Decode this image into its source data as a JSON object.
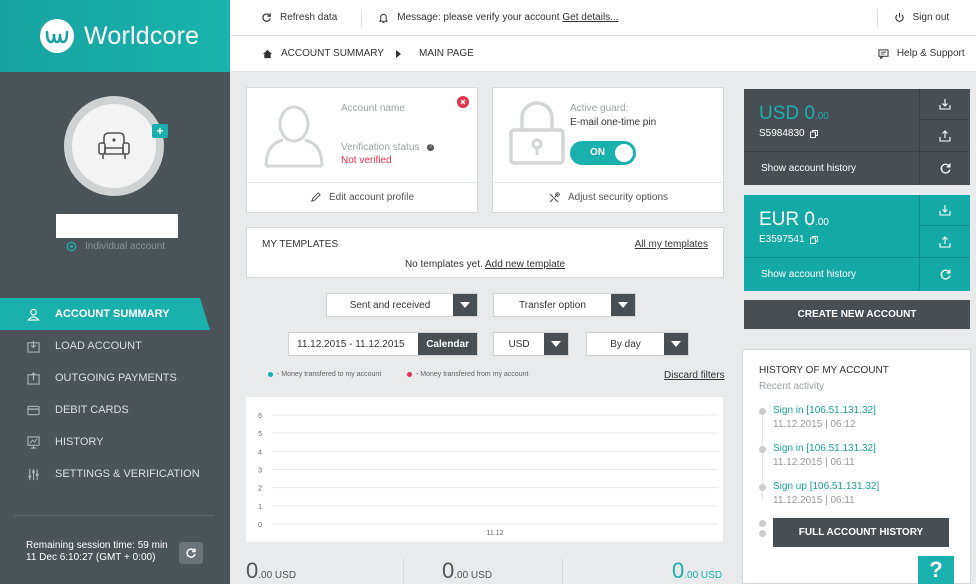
{
  "brand": {
    "name": "Worldcore"
  },
  "sidebar": {
    "account_type": "Individual account",
    "items": [
      {
        "label": "ACCOUNT SUMMARY",
        "icon": "user-icon",
        "active": true
      },
      {
        "label": "LOAD ACCOUNT",
        "icon": "load-icon"
      },
      {
        "label": "OUTGOING PAYMENTS",
        "icon": "upload-icon"
      },
      {
        "label": "DEBIT CARDS",
        "icon": "card-icon"
      },
      {
        "label": "HISTORY",
        "icon": "chart-icon"
      },
      {
        "label": "SETTINGS & VERIFICATION",
        "icon": "sliders-icon"
      }
    ],
    "session_line1": "Remaining session time: 59 min",
    "session_line2": "11 Dec 6:10:27 (GMT + 0:00)"
  },
  "topbar": {
    "refresh": "Refresh data",
    "message": "Message: please verify your account",
    "message_link": "Get details...",
    "signout": "Sign out"
  },
  "breadcrumb": {
    "first": "ACCOUNT SUMMARY",
    "second": "MAIN PAGE",
    "help": "Help & Support"
  },
  "profile": {
    "name_label": "Account name",
    "status_label": "Verification status",
    "status_value": "Not verified",
    "edit": "Edit account profile"
  },
  "security": {
    "guard_label": "Active guard:",
    "guard_value": "E-mail one-time pin",
    "toggle": "ON",
    "adjust": "Adjust security options"
  },
  "templates": {
    "title": "MY TEMPLATES",
    "all_link": "All my templates",
    "empty": "No templates yet.",
    "add_link": "Add new template"
  },
  "filters": {
    "direction": "Sent and received",
    "transfer": "Transfer option",
    "date_range": "11.12.2015 - 11.12.2015",
    "calendar": "Calendar",
    "currency": "USD",
    "period": "By day",
    "legend_in": "- Money transfered to my account",
    "legend_out": "- Money transfered from my account",
    "discard": "Discard filters",
    "color_in": "#1ab0ad",
    "color_out": "#e0334d"
  },
  "chart_data": {
    "type": "line",
    "categories": [
      "11.12"
    ],
    "ylim": [
      0,
      6
    ],
    "yticks": [
      "0",
      "1",
      "2",
      "3",
      "4",
      "5",
      "6"
    ],
    "series": [
      {
        "values": [
          0
        ]
      },
      {
        "values": [
          0
        ]
      }
    ]
  },
  "totals": [
    {
      "int": "0",
      "dec": ".00 USD",
      "color": "#555"
    },
    {
      "int": "0",
      "dec": ".00 USD",
      "color": "#555"
    },
    {
      "int": "0",
      "dec": ".00 USD",
      "color": "#1ab0ad"
    }
  ],
  "accounts": [
    {
      "currency": "USD 0",
      "cents": ".00",
      "number": "S5984830",
      "history": "Show account history"
    },
    {
      "currency": "EUR 0",
      "cents": ".00",
      "number": "E3597541",
      "history": "Show account history"
    }
  ],
  "create_account": "CREATE NEW ACCOUNT",
  "history": {
    "title": "HISTORY OF MY ACCOUNT",
    "subtitle": "Recent activity",
    "items": [
      {
        "title": "Sign in [106.51.131.32]",
        "date": "11.12.2015 | 06:12"
      },
      {
        "title": "Sign in [106.51.131.32]",
        "date": "11.12.2015 | 06:11"
      },
      {
        "title": "Sign up [106.51.131.32]",
        "date": "11.12.2015 | 06:11"
      }
    ],
    "full_button": "FULL ACCOUNT HISTORY"
  },
  "help_button": "?"
}
